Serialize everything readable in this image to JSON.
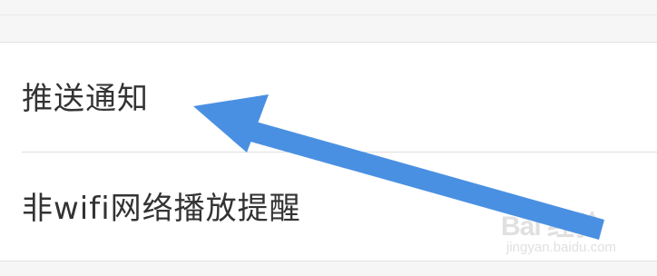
{
  "settings": {
    "items": [
      {
        "label": "推送通知"
      },
      {
        "label": "非wifi网络播放提醒"
      }
    ]
  },
  "annotation": {
    "arrow_color": "#4a90e2",
    "points_to": "推送通知"
  },
  "watermark": {
    "logo_text": "Bai 经验",
    "domain_text": "jingyan.baidu.com"
  },
  "colors": {
    "background": "#ffffff",
    "section_gap": "#f6f6f6",
    "divider": "#e0e0e0",
    "label_text": "#333333"
  }
}
